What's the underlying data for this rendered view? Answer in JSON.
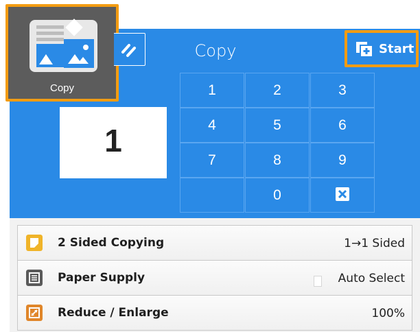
{
  "colors": {
    "panel_blue": "#2a8ae6",
    "highlight_orange": "#f39c12",
    "tile_gray": "#5c5c5c"
  },
  "app": {
    "label": "Copy",
    "icon": "copy-app-icon"
  },
  "header": {
    "title": "Copy",
    "reset_icon": "reset-icon",
    "start_label": "Start",
    "start_icon": "start-icon"
  },
  "quantity": {
    "value": "1"
  },
  "keypad": {
    "keys": [
      "1",
      "2",
      "3",
      "4",
      "5",
      "6",
      "7",
      "8",
      "9",
      "0"
    ],
    "clear_icon": "clear-icon"
  },
  "settings": [
    {
      "label": "2 Sided Copying",
      "value": "1→1 Sided",
      "icon": "two-sided-icon",
      "color": "#f0b429"
    },
    {
      "label": "Paper Supply",
      "value": "Auto Select",
      "icon": "paper-supply-icon",
      "color": "#5a5a5a"
    },
    {
      "label": "Reduce / Enlarge",
      "value": "100%",
      "icon": "reduce-enlarge-icon",
      "color": "#e0862a"
    }
  ]
}
